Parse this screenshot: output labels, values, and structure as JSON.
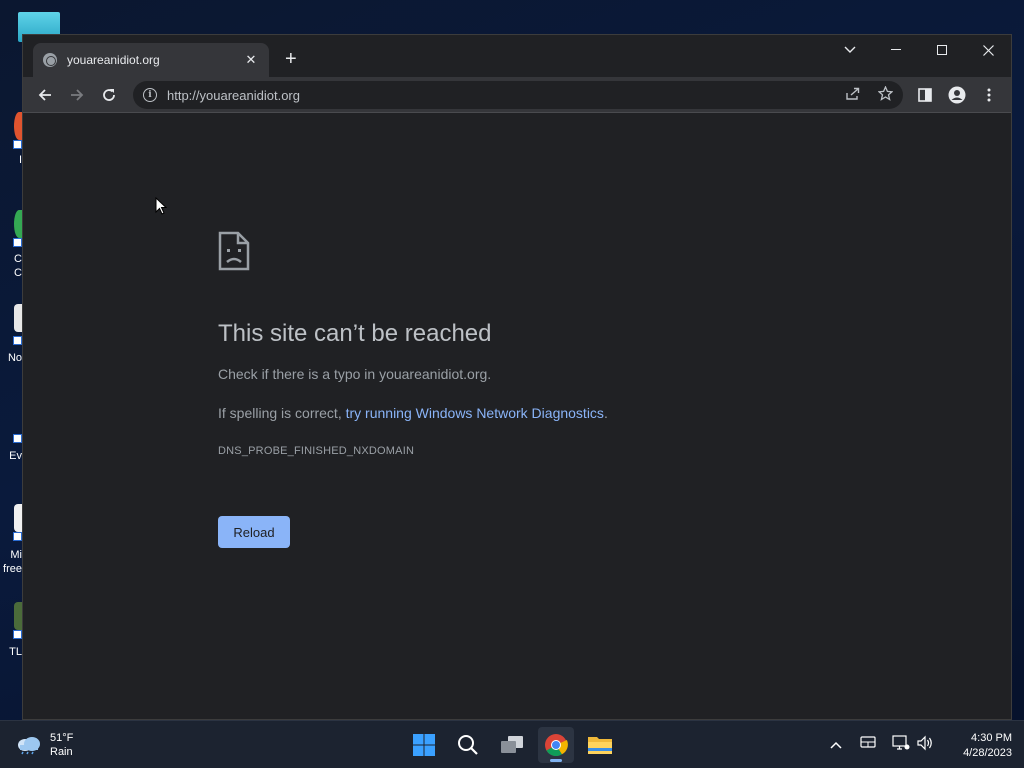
{
  "browser": {
    "tab_title": "youareanidiot.org",
    "url": "http://youareanidiot.org"
  },
  "error_page": {
    "title": "This site can’t be reached",
    "line1": "Check if there is a typo in youareanidiot.org.",
    "line2_prefix": "If spelling is correct, ",
    "line2_link": "try running Windows Network Diagnostics",
    "line2_suffix": ".",
    "error_code": "DNS_PROBE_FINISHED_NXDOMAIN",
    "reload_label": "Reload"
  },
  "desktop": {
    "icon_labels": [
      "I",
      "C\nC",
      "No",
      "Ev",
      "Mi\nfree",
      "TL"
    ]
  },
  "taskbar": {
    "weather_temp": "51°F",
    "weather_desc": "Rain",
    "time": "4:30 PM",
    "date": "4/28/2023"
  },
  "colors": {
    "accent_link": "#8ab4f8",
    "page_bg": "#202124",
    "toolbar_bg": "#35363a"
  },
  "icons": [
    "globe-icon",
    "close-icon",
    "plus-icon",
    "chevron-down-icon",
    "minimize-icon",
    "maximize-icon",
    "back-icon",
    "forward-icon",
    "reload-icon",
    "info-icon",
    "share-icon",
    "star-icon",
    "side-panel-icon",
    "profile-icon",
    "menu-icon",
    "sad-document-icon",
    "cursor-icon",
    "weather-icon",
    "windows-start-icon",
    "search-icon",
    "task-view-icon",
    "chrome-icon",
    "file-explorer-icon",
    "caret-up-icon",
    "keyboard-icon",
    "network-icon",
    "volume-icon"
  ]
}
